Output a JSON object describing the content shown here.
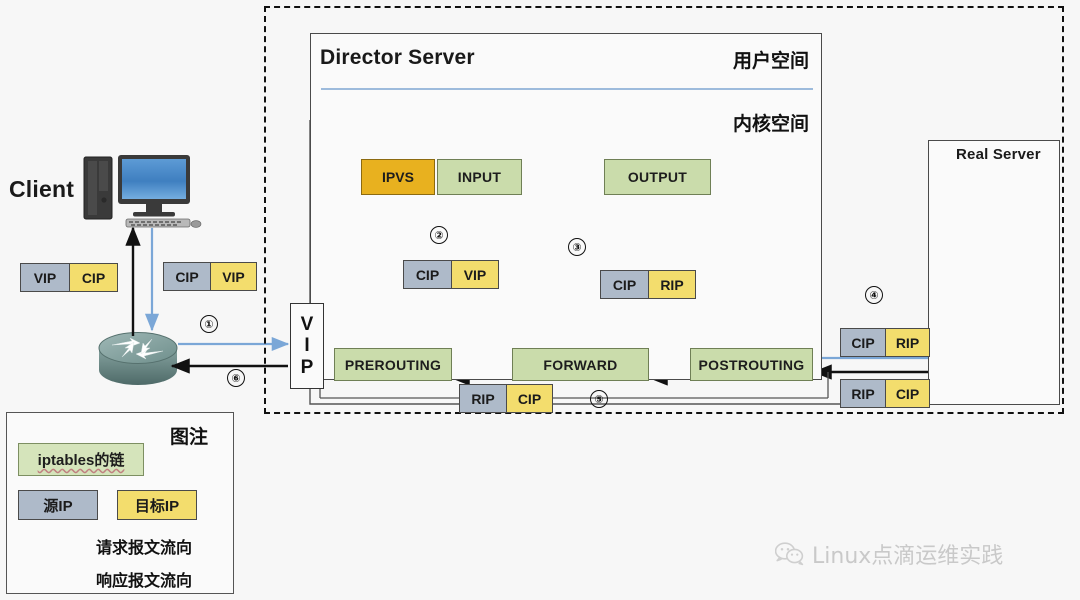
{
  "diagram": {
    "title_director": "Director Server",
    "title_realserver": "Real Server",
    "label_client": "Client",
    "label_user_space": "用户空间",
    "label_kernel_space": "内核空间"
  },
  "chains": {
    "ipvs": "IPVS",
    "input": "INPUT",
    "output": "OUTPUT",
    "prerouting": "PREROUTING",
    "forward": "FORWARD",
    "postrouting": "POSTROUTING"
  },
  "vip_gateway": {
    "line1": "V",
    "line2": "I",
    "line3": "P"
  },
  "ip_pairs": {
    "client_resp": {
      "src": "VIP",
      "dst": "CIP"
    },
    "client_req": {
      "src": "CIP",
      "dst": "VIP"
    },
    "prerouting_in": {
      "src": "CIP",
      "dst": "VIP"
    },
    "postrouting_out": {
      "src": "CIP",
      "dst": "RIP"
    },
    "return_in": {
      "src": "RIP",
      "dst": "CIP"
    },
    "rs_in": {
      "src": "CIP",
      "dst": "RIP"
    },
    "rs_out": {
      "src": "RIP",
      "dst": "CIP"
    }
  },
  "steps": {
    "s1": "①",
    "s2": "②",
    "s3": "③",
    "s4": "④",
    "s5": "⑤",
    "s6": "⑥"
  },
  "legend": {
    "title": "图注",
    "chain_label": "iptables的链",
    "src_label": "源IP",
    "dst_label": "目标IP",
    "request_flow": "请求报文流向",
    "response_flow": "响应报文流向"
  },
  "watermark": {
    "text": "Linux点滴运维实践"
  },
  "colors": {
    "chain_green": "#cadcab",
    "ipvs_amber": "#e8b11f",
    "src_blue_gray": "#aebac9",
    "dst_yellow": "#f3dd6d",
    "request_arrow": "#7ba7d7",
    "response_arrow": "#111111",
    "background": "#f7f7f7"
  }
}
